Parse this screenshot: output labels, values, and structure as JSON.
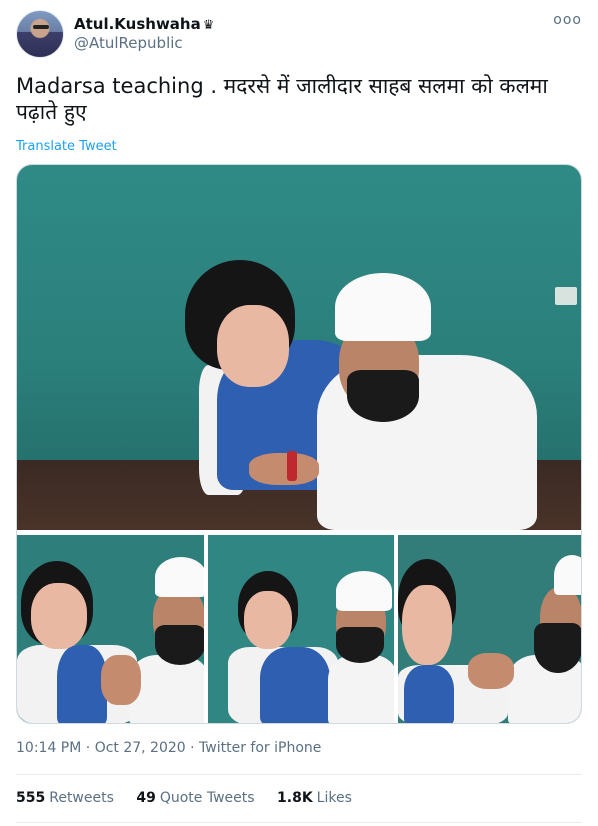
{
  "author": {
    "display_name": "Atul.Kushwaha",
    "badge_glyph": "♛",
    "handle": "@AtulRepublic",
    "avatar_icon": "avatar-photo"
  },
  "menu": {
    "more_glyph": "ooo"
  },
  "tweet": {
    "text": "Madarsa teaching . मदरसे में जालीदार साहब सलमा को कलमा पढ़ाते हुए",
    "translate_label": "Translate Tweet"
  },
  "media": {
    "photos": [
      "photo-1",
      "photo-2",
      "photo-3",
      "photo-4"
    ]
  },
  "meta": {
    "time": "10:14 PM",
    "separator": "·",
    "date": "Oct 27, 2020",
    "source": "Twitter for iPhone"
  },
  "stats": {
    "retweets_count": "555",
    "retweets_label": "Retweets",
    "quotes_count": "49",
    "quotes_label": "Quote Tweets",
    "likes_count": "1.8K",
    "likes_label": "Likes"
  },
  "colors": {
    "link": "#1da1f2",
    "secondary_text": "#5b7083",
    "divider": "#e6ecf0"
  }
}
